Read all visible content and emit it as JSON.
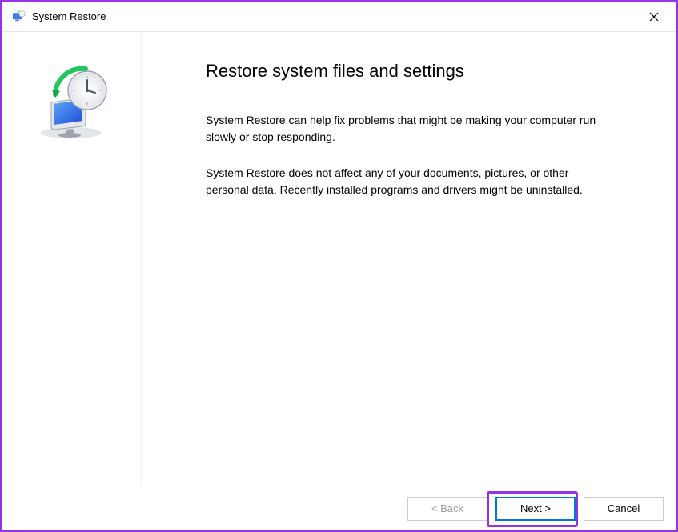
{
  "titlebar": {
    "title": "System Restore"
  },
  "content": {
    "heading": "Restore system files and settings",
    "paragraph1": "System Restore can help fix problems that might be making your computer run slowly or stop responding.",
    "paragraph2": "System Restore does not affect any of your documents, pictures, or other personal data. Recently installed programs and drivers might be uninstalled."
  },
  "footer": {
    "back_label": "< Back",
    "next_label": "Next >",
    "cancel_label": "Cancel"
  }
}
